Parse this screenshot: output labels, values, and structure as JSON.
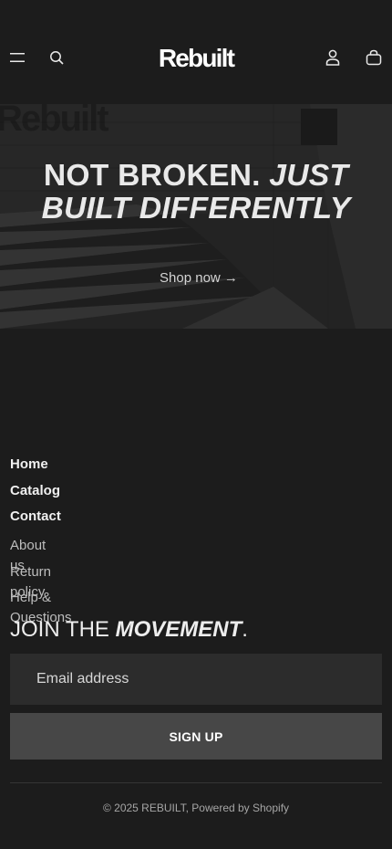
{
  "header": {
    "logo": "Rebuilt",
    "icons": [
      "menu-icon",
      "search-icon",
      "account-icon",
      "cart-icon"
    ]
  },
  "hero": {
    "watermark": "Rebuilt",
    "title_line1_bold": "NOT BROKEN.",
    "title_line1_italic": "JUST",
    "title_line2_italic": "BUILT DIFFERENTLY",
    "cta_label": "Shop now →"
  },
  "footer": {
    "primary_links": [
      "Home",
      "Catalog",
      "Contact"
    ],
    "secondary_links": [
      "About us",
      "Return policy",
      "Help & Questions"
    ],
    "newsletter": {
      "heading_plain": "JOIN THE ",
      "heading_emphasis": "MOVEMENT",
      "heading_suffix": ".",
      "email_placeholder": "Email address",
      "button_label": "SIGN UP"
    },
    "copyright": "© 2025 REBUILT, Powered by Shopify"
  },
  "colors": {
    "background": "#1c1c1c",
    "input_background": "#2c2c2c",
    "button_background": "#474747",
    "text": "#e6e6e6"
  }
}
